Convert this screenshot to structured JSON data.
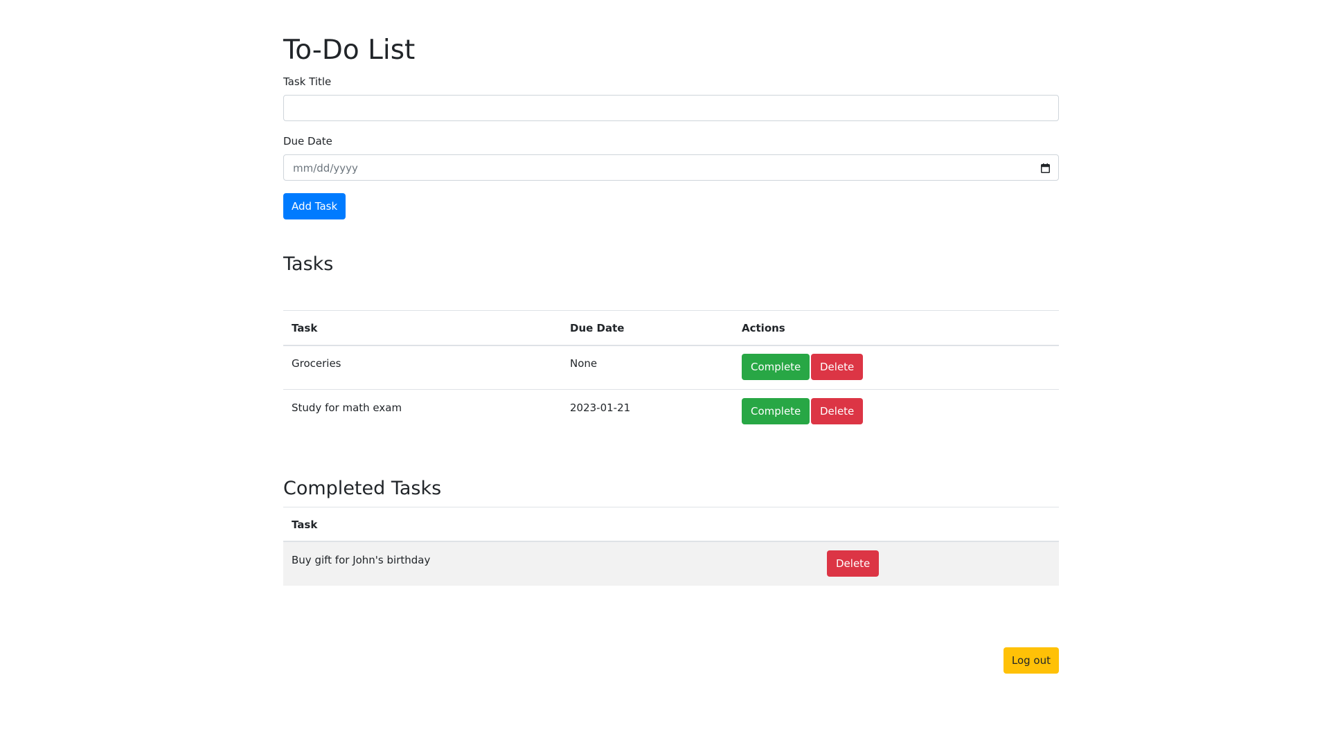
{
  "page": {
    "title": "To-Do List"
  },
  "form": {
    "task_title_label": "Task Title",
    "task_title_value": "",
    "due_date_label": "Due Date",
    "due_date_placeholder": "mm/dd/yyyy",
    "add_button": "Add Task"
  },
  "tasks": {
    "heading": "Tasks",
    "columns": [
      "Task",
      "Due Date",
      "Actions"
    ],
    "rows": [
      {
        "task": "Groceries",
        "due": "None",
        "complete": "Complete",
        "delete": "Delete"
      },
      {
        "task": "Study for math exam",
        "due": "2023-01-21",
        "complete": "Complete",
        "delete": "Delete"
      }
    ]
  },
  "completed": {
    "heading": "Completed Tasks",
    "columns": [
      "Task"
    ],
    "rows": [
      {
        "task": "Buy gift for John's birthday",
        "delete": "Delete"
      }
    ]
  },
  "footer": {
    "logout": "Log out"
  },
  "colors": {
    "primary": "#007bff",
    "success": "#28a745",
    "danger": "#dc3545",
    "warning": "#ffc107"
  },
  "icons": {
    "date_picker": "calendar-icon"
  }
}
